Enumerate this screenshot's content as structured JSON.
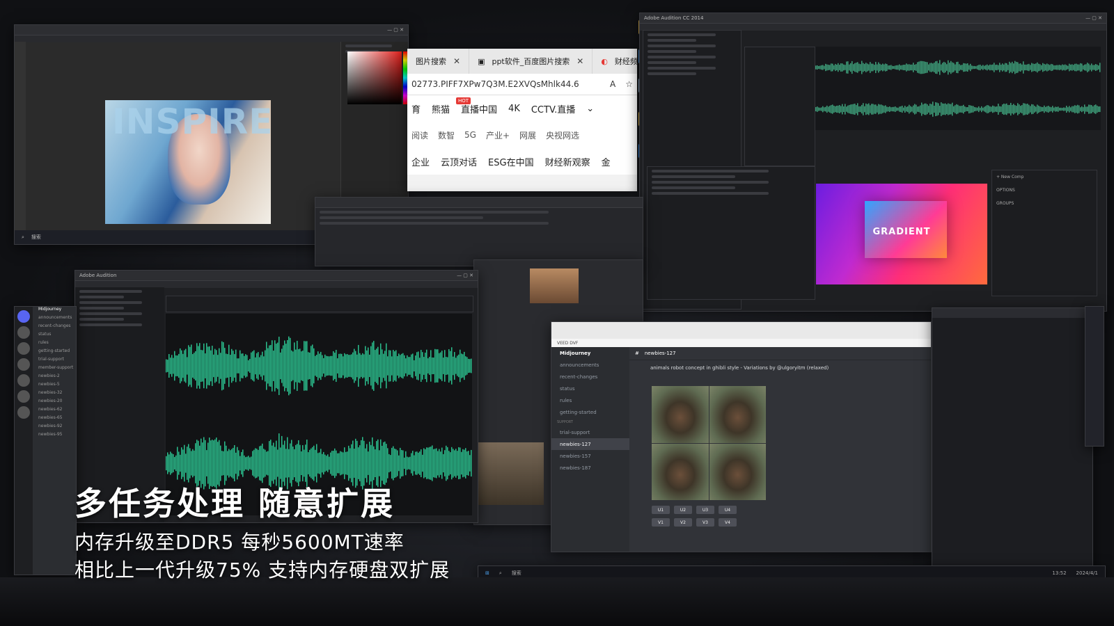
{
  "overlay": {
    "headline": "多任务处理 随意扩展",
    "line1": "内存升级至DDR5 每秒5600MT速率",
    "line2": "相比上一代升级75% 支持内存硬盘双扩展"
  },
  "photoshop": {
    "canvas_text": "INSPIRE",
    "taskbar_search": "搜索"
  },
  "browser": {
    "tabs": [
      {
        "label": "图片搜索"
      },
      {
        "label": "ppt软件_百度图片搜索"
      },
      {
        "label": "财经频道"
      }
    ],
    "address": "02773.PIFF7XPw7Q3M.E2XVQsMhlk44.6",
    "nav_row1": [
      "育",
      "熊猫",
      "直播中国",
      "4K",
      "CCTV.直播"
    ],
    "hot_badge": "HOT",
    "nav_row2": [
      "阅读",
      "数智",
      "5G",
      "产业+",
      "网展",
      "央视网选"
    ],
    "nav_row3": [
      "企业",
      "云顶对话",
      "ESG在中国",
      "财经新观察",
      "金"
    ]
  },
  "audition_main": {
    "title": "Adobe Audition CC 2014",
    "composition_text": "GRADIENT",
    "options": [
      "OPTIONS",
      "GROUPS",
      "+ New Comp"
    ]
  },
  "audition_second": {
    "title": "Adobe Audition"
  },
  "discord_left": {
    "server": "Midjourney",
    "channels": [
      "announcements",
      "recent-changes",
      "status",
      "rules",
      "getting-started",
      "trial-support",
      "member-support",
      "newbies-2",
      "newbies-5",
      "newbies-32",
      "newbies-20",
      "newbies-62",
      "newbies-65",
      "newbies-92",
      "newbies-95"
    ]
  },
  "discord_right": {
    "server": "Midjourney",
    "channel_header": "newbies-127",
    "channels": [
      {
        "section": "",
        "name": "announcements"
      },
      {
        "section": "",
        "name": "recent-changes"
      },
      {
        "section": "",
        "name": "status"
      },
      {
        "section": "",
        "name": "rules"
      },
      {
        "section": "",
        "name": "getting-started"
      },
      {
        "section": "SUPPORT",
        "name": "trial-support"
      },
      {
        "section": "",
        "name": "newbies-127"
      },
      {
        "section": "",
        "name": "newbies-157"
      },
      {
        "section": "",
        "name": "newbies-187"
      }
    ],
    "message": "animals robot concept in ghibli style - Variations by @ulgoryitm (relaxed)",
    "buttons": [
      "U1",
      "U2",
      "U3",
      "U4",
      "V1",
      "V2",
      "V3",
      "V4"
    ],
    "bookmark": "VEED DVF"
  },
  "desktop_taskbar": {
    "search_text": "搜索",
    "time": "13:52",
    "date": "2024/4/1"
  }
}
